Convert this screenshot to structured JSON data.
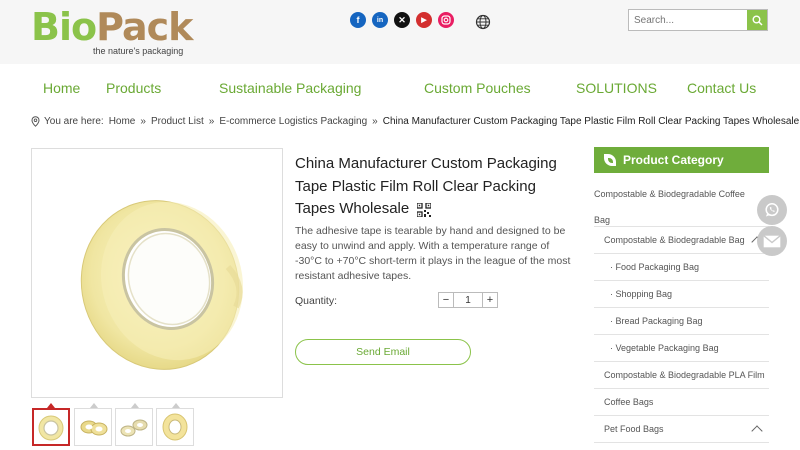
{
  "header": {
    "logo_bio": "Bio",
    "logo_pack": "Pack",
    "logo_tagline": "the nature's packaging",
    "social_icons": [
      "facebook-icon",
      "linkedin-icon",
      "x-icon",
      "youtube-icon",
      "instagram-icon"
    ],
    "social_colors": [
      "#1565c0",
      "#1565c0",
      "#111111",
      "#d32f2f",
      "#e91e63"
    ],
    "search_placeholder": "Search..."
  },
  "nav": {
    "items": [
      "Home",
      "Products",
      "Sustainable Packaging",
      "Custom Pouches",
      "SOLUTIONS",
      "Contact Us"
    ]
  },
  "breadcrumb": {
    "prefix": "You are here:",
    "links": [
      "Home",
      "Product List",
      "E-commerce Logistics Packaging"
    ],
    "separator": "»",
    "current": "China Manufacturer Custom Packaging Tape Plastic Film Roll Clear Packing Tapes Wholesale"
  },
  "product": {
    "title": "China Manufacturer Custom Packaging Tape Plastic Film Roll Clear Packing Tapes Wholesale",
    "description": "The adhesive tape is tearable by hand and designed to be easy to unwind and apply. With a temperature range of -30°C to +70°C short-term it plays in the league of the most resistant adhesive tapes.",
    "quantity_label": "Quantity:",
    "quantity_value": "1",
    "minus": "−",
    "plus": "+",
    "send_email": "Send Email"
  },
  "category": {
    "heading": "Product Category",
    "items": [
      {
        "label": "Compostable & Biodegradable Coffee Bag",
        "sub": false
      },
      {
        "label": "Compostable & Biodegradable Bag",
        "sub": false,
        "expanded": true
      },
      {
        "label": "· Food Packaging Bag",
        "sub": true
      },
      {
        "label": "· Shopping Bag",
        "sub": true
      },
      {
        "label": "· Bread Packaging Bag",
        "sub": true
      },
      {
        "label": "· Vegetable Packaging Bag",
        "sub": true
      },
      {
        "label": "Compostable & Biodegradable PLA Film",
        "sub": false
      },
      {
        "label": "Coffee Bags",
        "sub": false
      },
      {
        "label": "Pet Food Bags",
        "sub": false,
        "expanded": true
      }
    ]
  },
  "colors": {
    "brand_green": "#8bc34a",
    "nav_green": "#6aa934",
    "active_thumb_border": "#c62828"
  },
  "floating": [
    "whatsapp-icon",
    "email-icon"
  ]
}
